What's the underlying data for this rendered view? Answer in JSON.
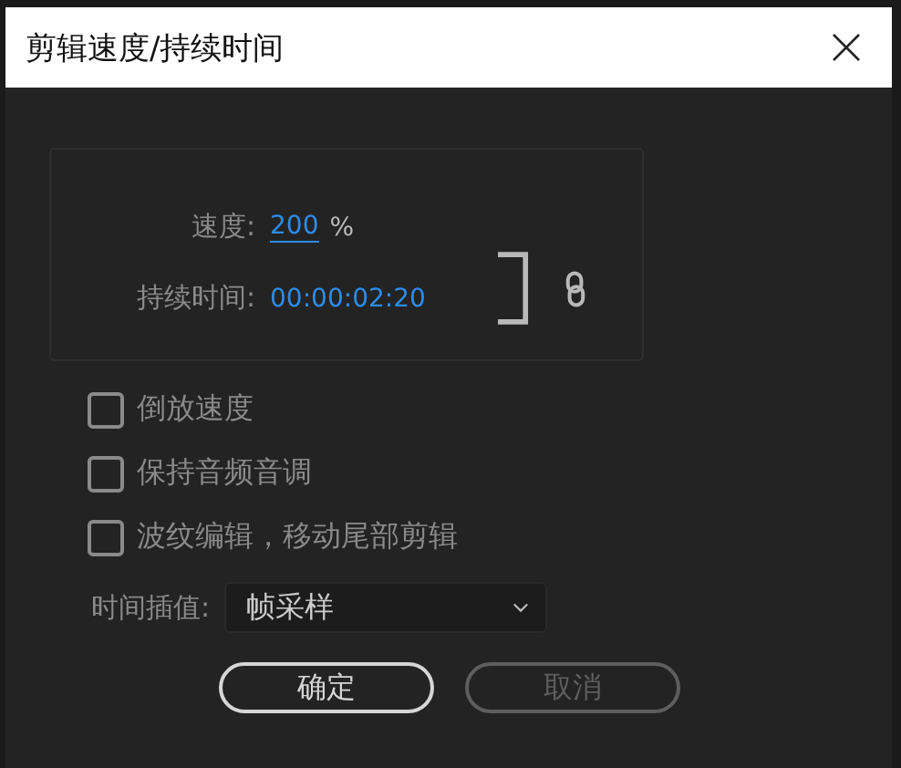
{
  "dialog": {
    "title": "剪辑速度/持续时间"
  },
  "speed": {
    "label": "速度:",
    "value": "200",
    "unit": "%"
  },
  "duration": {
    "label": "持续时间:",
    "value": "00:00:02:20"
  },
  "linked": true,
  "options": [
    {
      "label": "倒放速度",
      "checked": false
    },
    {
      "label": "保持音频音调",
      "checked": false
    },
    {
      "label": "波纹编辑，移动尾部剪辑",
      "checked": false
    }
  ],
  "interpolation": {
    "label": "时间插值:",
    "value": "帧采样"
  },
  "buttons": [
    {
      "label": "确定",
      "disabled": false
    },
    {
      "label": "取消",
      "disabled": true
    }
  ]
}
